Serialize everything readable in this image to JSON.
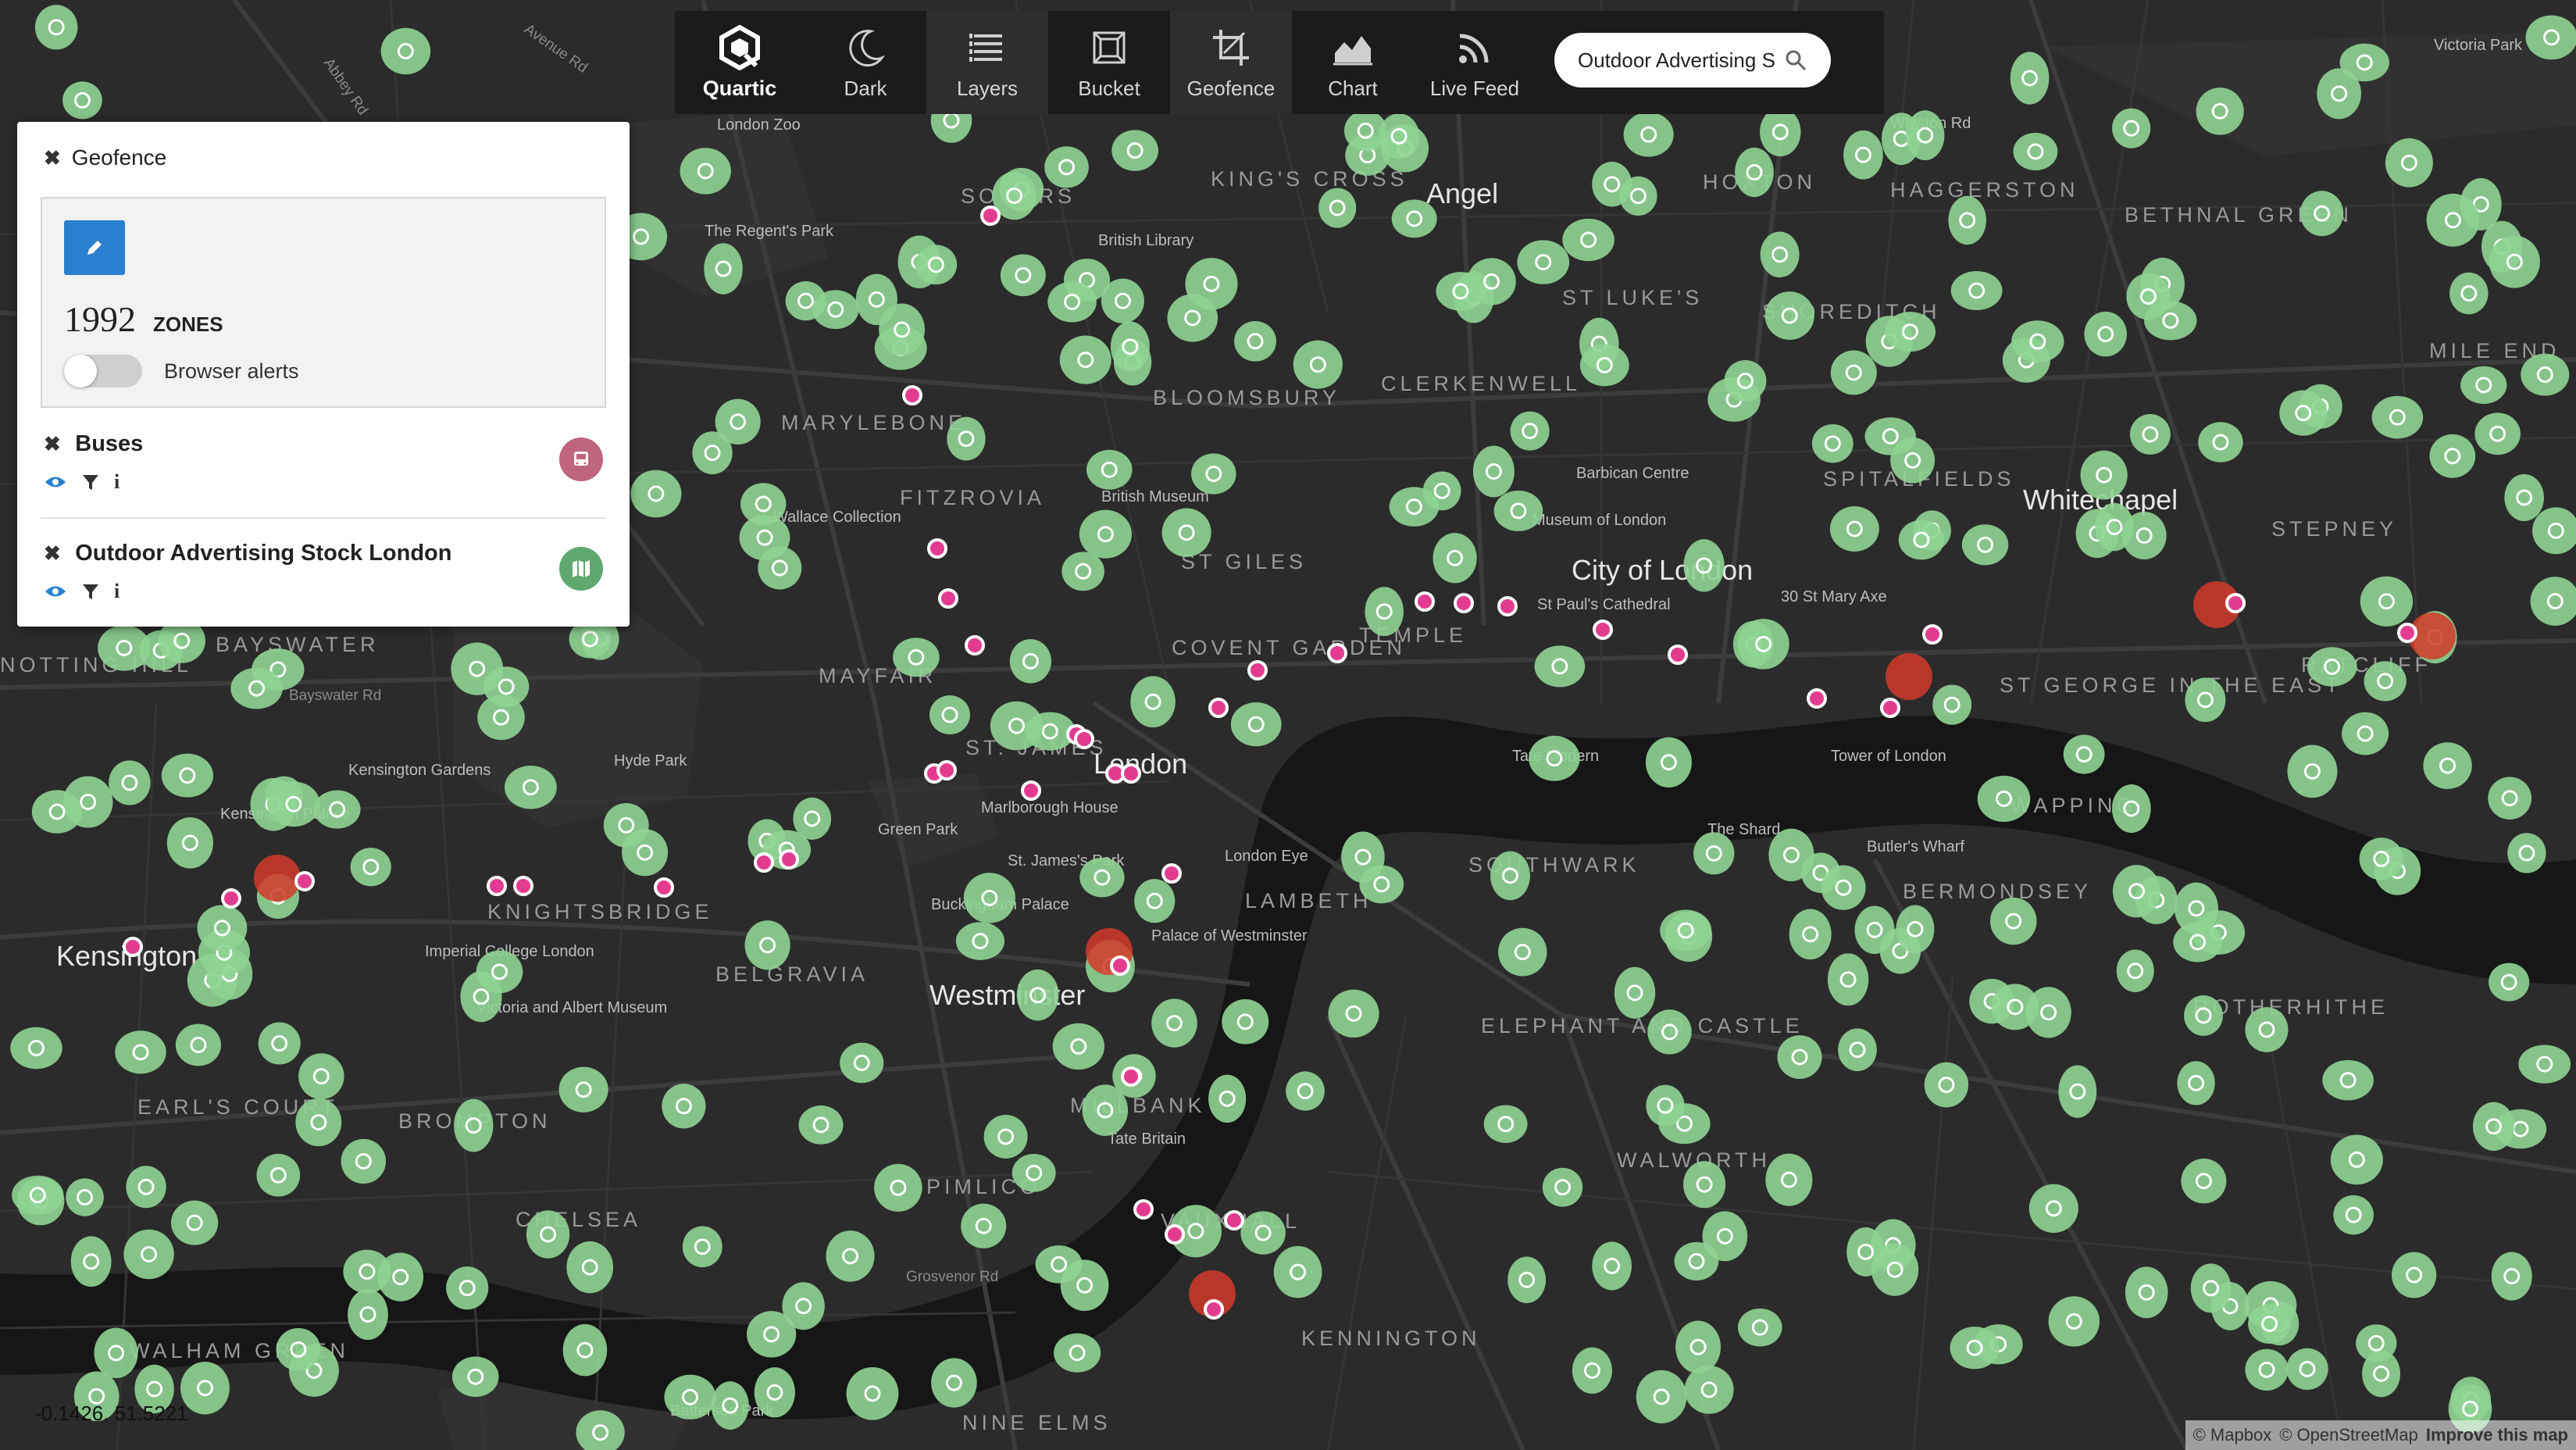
{
  "toolbar": {
    "logo_label": "Quartic",
    "items": [
      {
        "label": "Dark",
        "icon": "moon-icon"
      },
      {
        "label": "Layers",
        "icon": "layers-icon"
      },
      {
        "label": "Bucket",
        "icon": "bucket-icon"
      },
      {
        "label": "Geofence",
        "icon": "crop-icon"
      },
      {
        "label": "Chart",
        "icon": "area-chart-icon"
      },
      {
        "label": "Live Feed",
        "icon": "rss-icon"
      }
    ],
    "search_value": "Outdoor Advertising S"
  },
  "geofence_panel": {
    "title": "Geofence",
    "zones_count": "1992",
    "zones_label": "ZONES",
    "browser_alerts_label": "Browser alerts",
    "browser_alerts_on": false
  },
  "layers": [
    {
      "name": "Buses",
      "badge_color": "#c0657e",
      "badge_icon": "bus-icon"
    },
    {
      "name": "Outdoor Advertising Stock London",
      "badge_color": "#5fa86e",
      "badge_icon": "map-icon"
    }
  ],
  "map": {
    "labels": {
      "london_zoo": "London Zoo",
      "somers": "SOMERS",
      "kings_cross": "KING'S CROSS",
      "angel": "Angel",
      "hoxton": "HOXTON",
      "haggerston": "HAGGERSTON",
      "whiston_rd": "Whiston Rd",
      "bethnal_green": "BETHNAL GREEN",
      "victoria_park": "Victoria Park",
      "regents_park": "The Regent's Park",
      "british_library": "British Library",
      "st_lukes": "ST LUKE'S",
      "shoreditch": "SHOREDITCH",
      "mile_end": "MILE END",
      "marylebone": "MARYLEBONE",
      "clerkenwell": "CLERKENWELL",
      "bloomsbury": "BLOOMSBURY",
      "fitzrovia": "FITZROVIA",
      "british_museum": "British Museum",
      "barbican": "Barbican Centre",
      "museum_of_london": "Museum of London",
      "spitalfields": "SPITALFIELDS",
      "whitechapel": "Whitechapel",
      "stepney": "STEPNEY",
      "wallace": "Wallace Collection",
      "st_giles": "ST GILES",
      "city_of_london": "City of London",
      "bayswater": "BAYSWATER",
      "mayfair": "MAYFAIR",
      "covent_garden": "COVENT GARDEN",
      "temple": "TEMPLE",
      "st_pauls": "St Paul's Cathedral",
      "st_mary_axe": "30 St Mary Axe",
      "ratcliff": "RATCLIFF",
      "notting_hill": "NOTTING HILL",
      "bayswater_rd": "Bayswater Rd",
      "hyde_park": "Hyde Park",
      "st_james": "ST. JAMES",
      "london": "London",
      "tate_modern": "Tate Modern",
      "tower_of_london": "Tower of London",
      "st_george": "ST GEORGE IN THE EAST",
      "kensington_gardens": "Kensington Gardens",
      "kensington_palace": "Kensington Palace",
      "marlborough_house": "Marlborough House",
      "green_park": "Green Park",
      "the_shard": "The Shard",
      "wapping": "WAPPING",
      "butlers_wharf": "Butler's Wharf",
      "london_eye": "London Eye",
      "southwark": "SOUTHWARK",
      "st_jamess_park": "St. James's Park",
      "knightsbridge": "KNIGHTSBRIDGE",
      "lambeth": "LAMBETH",
      "bermondsey": "BERMONDSEY",
      "kensington": "Kensington",
      "imperial_college": "Imperial College London",
      "buckingham_palace": "Buckingham Palace",
      "palace_of_westminster": "Palace of Westminster",
      "victoria_albert": "Victoria and Albert Museum",
      "belgravia": "BELGRAVIA",
      "westminster": "Westminster",
      "elephant_castle": "ELEPHANT AND CASTLE",
      "rotherhithe": "ROTHERHITHE",
      "earls_court": "EARL'S COURT",
      "brompton": "BROMPTON",
      "millbank": "MILLBANK",
      "tate_britain": "Tate Britain",
      "walworth": "WALWORTH",
      "pimlico": "PIMLICO",
      "chelsea": "CHELSEA",
      "vauxhall": "VAUXHALL",
      "grosvenor_rd": "Grosvenor Rd",
      "walham_green": "WALHAM GREEN",
      "kennington": "KENNINGTON",
      "battersea_park": "Battersea Park",
      "nine_elms": "NINE ELMS",
      "avenue_rd": "Avenue Rd",
      "abbey_rd": "Abbey Rd"
    }
  },
  "coordinates_readout": "-0.1426, 51.5221",
  "attribution": {
    "mapbox": "© Mapbox",
    "osm": "© OpenStreetMap",
    "improve": "Improve this map"
  },
  "colors": {
    "map_background": "#2b2b2b",
    "zone_fill": "#8fd493",
    "bus_point": "#e23b8f",
    "hotspot": "#d23a2a",
    "accent": "#2a7fce"
  }
}
